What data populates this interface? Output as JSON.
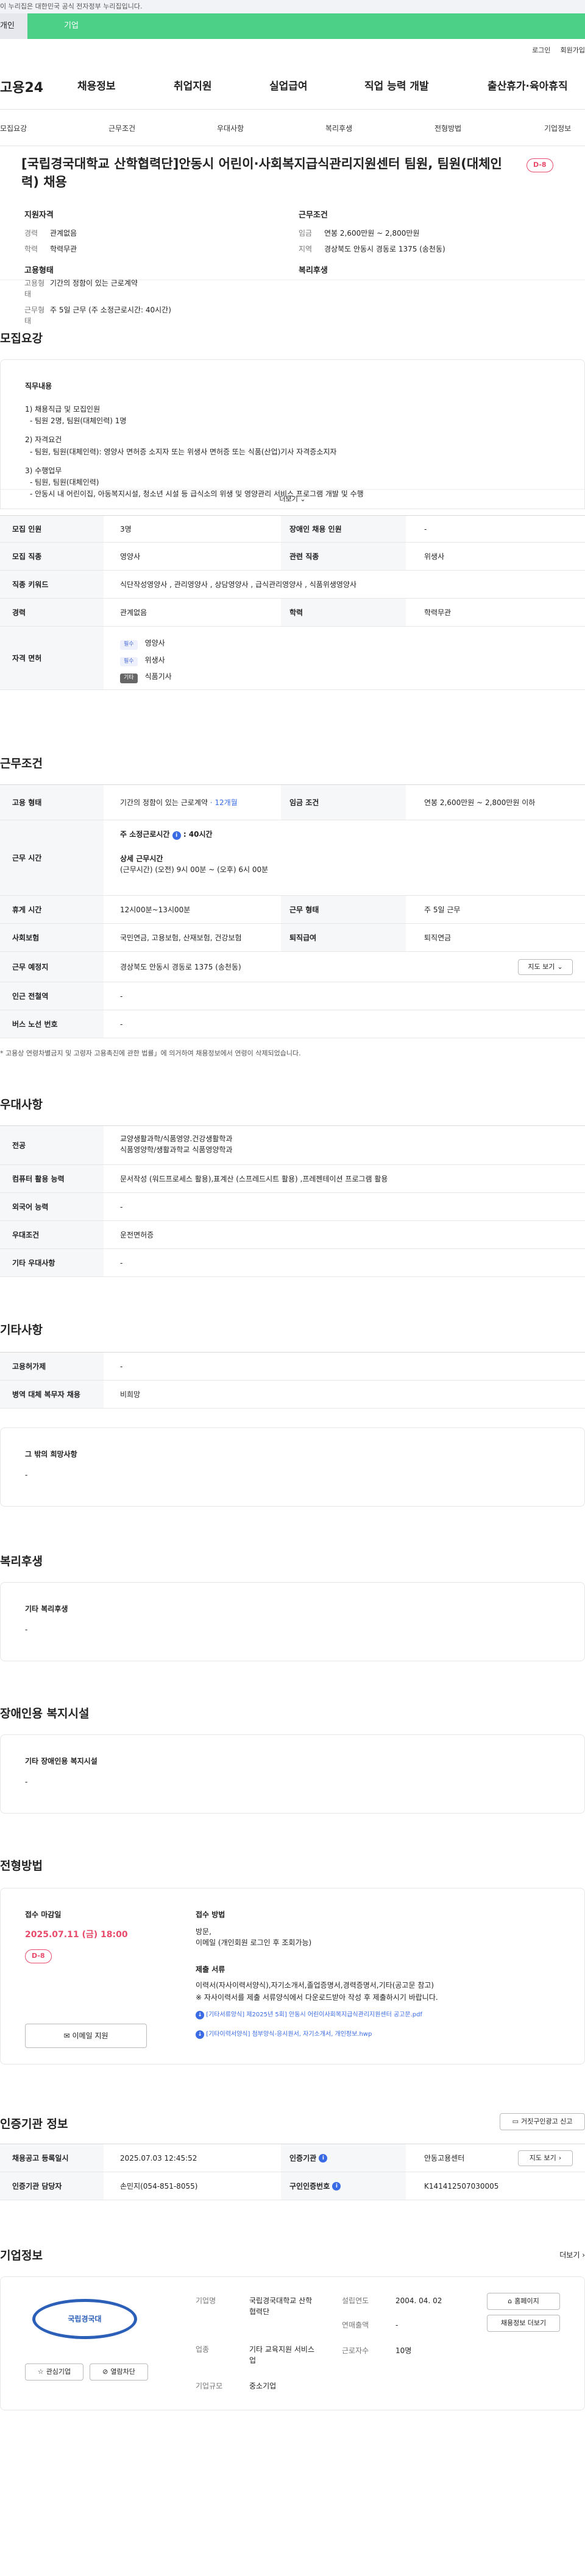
{
  "gov_banner": "이 누리집은 대한민국 공식 전자정부 누리집입니다.",
  "top_tabs": {
    "personal": "개인",
    "company": "기업"
  },
  "util": {
    "login": "로그인",
    "signup": "회원가입"
  },
  "gnb": {
    "logo": "고용24",
    "items": [
      "채용정보",
      "취업지원",
      "실업급여",
      "직업 능력 개발",
      "출산휴가·육아휴직"
    ]
  },
  "subnav": [
    "모집요강",
    "근무조건",
    "우대사항",
    "복리후생",
    "전형방법",
    "기업정보"
  ],
  "job": {
    "title": "[국립경국대학교 산학협력단]안동시 어린이·사회복지급식관리지원센터 팀원, 팀원(대체인력) 채용",
    "dday": "D-8",
    "qual_h": "지원자격",
    "career_k": "경력",
    "career_v": "관계없음",
    "edu_k": "학력",
    "edu_v": "학력무관",
    "cond_h": "근무조건",
    "wage_k": "임금",
    "wage_v": "연봉 2,600만원 ~ 2,800만원",
    "area_k": "지역",
    "area_v": "경상북도 안동시 경동로 1375 (송천동)",
    "emp_h": "고용형태",
    "emptype_k": "고용형태",
    "emptype_v": "기간의 정함이 있는 근로계약",
    "worktime_k": "근무형태",
    "worktime_v": "주 5일 근무 (주 소정근로시간: 40시간)",
    "welfare_h": "복리후생"
  },
  "recruit": {
    "title": "모집요강",
    "duty_h": "직무내용",
    "lines": [
      "1) 채용직급 및 모집인원",
      "- 팀원 2명, 팀원(대체인력) 1명",
      "2) 자격요건",
      "- 팀원, 팀원(대체인력): 영양사 면허증 소지자 또는 위생사 면허증 또는 식품(산업)기사 자격증소지자",
      "3) 수행업무",
      "- 팀원, 팀원(대체인력)",
      "- 안동시 내 어린이집, 아동복지시설, 청소년 시설 등 급식소의 위생 및 영양관리 서비스 프로그램 개발 및 수행"
    ],
    "more": "더보기",
    "rows": [
      {
        "k": "모집 인원",
        "v": "3명",
        "k2": "장애인 채용 인원",
        "v2": "-"
      },
      {
        "k": "모집 직종",
        "v": "영양사",
        "k2": "관련 직종",
        "v2": "위생사"
      },
      {
        "k": "직종 키워드",
        "v": "식단작성영양사 , 관리영양사 , 상담영양사 , 급식관리영양사 , 식품위생영양사"
      },
      {
        "k": "경력",
        "v": "관계없음",
        "k2": "학력",
        "v2": "학력무관"
      }
    ],
    "license_k": "자격 면허",
    "licenses": [
      {
        "tag": "필수",
        "name": "영양사"
      },
      {
        "tag": "필수",
        "name": "위생사"
      },
      {
        "tag": "기타",
        "name": "식품기사"
      }
    ]
  },
  "conditions": {
    "title": "근무조건",
    "emp_k": "고용 형태",
    "emp_v": "기간의 정함이 있는 근로계약",
    "emp_period": "· 12개월",
    "wage_k": "임금 조건",
    "wage_v": "연봉 2,600만원 ~ 2,800만원 이하",
    "time_k": "근무 시간",
    "weekly": "주 소정근로시간",
    "weekly_v": "40시간",
    "detail_h": "상세 근무시간",
    "detail_v": "(근무시간) (오전) 9시 00분 ~ (오후) 6시 00분",
    "rest_k": "휴게 시간",
    "rest_v": "12시00분~13시00분",
    "form_k": "근무 형태",
    "form_v": "주 5일 근무",
    "ins_k": "사회보험",
    "ins_v": "국민연금, 고용보험, 산재보험, 건강보험",
    "ret_k": "퇴직급여",
    "ret_v": "퇴직연금",
    "place_k": "근무 예정지",
    "place_v": "경상북도 안동시 경동로 1375 (송천동)",
    "map_btn": "지도 보기",
    "subway_k": "인근 전철역",
    "subway_v": "-",
    "bus_k": "버스 노선 번호",
    "bus_v": "-",
    "note": "* 고용상 연령차별금지 및 고령자 고용촉진에 관한 법률」에 의거하여 채용정보에서 연령이 삭제되었습니다."
  },
  "pref": {
    "title": "우대사항",
    "major_k": "전공",
    "major_v1": "교양생활과학/식품영양.건강생활학과",
    "major_v2": "식품영양학/생활과학교 식품영양학과",
    "pc_k": "컴퓨터 활용 능력",
    "pc_v": "문서작성 (워드프로세스 활용),표계산 (스프레드시트 활용) ,프레젠테이션 프로그램 활용",
    "lang_k": "외국어 능력",
    "lang_v": "-",
    "cond_k": "우대조건",
    "cond_v": "운전면허증",
    "etc_k": "기타 우대사항",
    "etc_v": "-"
  },
  "etc": {
    "title": "기타사항",
    "k1": "고용허가제",
    "v1": "-",
    "k2": "병역 대체 복무자 채용",
    "v2": "비희망",
    "other_h": "그 밖의 희망사항",
    "other_v": "-"
  },
  "welfare": {
    "title": "복리후생",
    "h": "기타 복리후생",
    "v": "-"
  },
  "disab": {
    "title": "장애인용 복지시설",
    "h": "기타 장애인용 복지시설",
    "v": "-"
  },
  "process": {
    "title": "전형방법",
    "deadline_h": "접수 마감일",
    "deadline_v": "2025.07.11 (금) 18:00",
    "dday": "D-8",
    "email_btn": "이메일 지원",
    "method_h": "접수 방법",
    "method_v": "방문,",
    "method_v2": "이메일 (개인회원 로그인 후 조회가능)",
    "docs_h": "제출 서류",
    "docs_v": "이력서(자사이력서양식),자기소개서,졸업증명서,경력증명서,기타(공고문 참고)",
    "docs_note": "※ 자사이력서를 제출 서류양식에서 다운로드받아 작성 후 제출하시기 바랍니다.",
    "file1": "[기타서류양식] 제2025년 5회] 안동시 어린이사회복지급식관리지원센터 공고문.pdf",
    "file2": "[기타이력서양식] 첨부양식-응시원서, 자기소개서, 개인정보.hwp"
  },
  "agency": {
    "title": "인증기관 정보",
    "report_btn": "거짓구인광고 신고",
    "reg_k": "채용공고 등록일시",
    "reg_v": "2025.07.03 12:45:52",
    "org_k": "인증기관",
    "org_v": "안동고용센터",
    "map_btn": "지도 보기",
    "mgr_k": "인증기관 담당자",
    "mgr_v": "손민지(054-851-8055)",
    "no_k": "구인인증번호",
    "no_v": "K141412507030005"
  },
  "company": {
    "title": "기업정보",
    "more": "더보기",
    "logo_text": "국립경국대",
    "fav": "관심기업",
    "block": "열람차단",
    "name_k": "기업명",
    "name_v": "국립경국대학교 산학협력단",
    "found_k": "설립연도",
    "found_v": "2004. 04. 02",
    "sales_k": "연매출액",
    "sales_v": "-",
    "ind_k": "업종",
    "ind_v": "기타 교육지원 서비스업",
    "emp_k": "근로자수",
    "emp_v": "10명",
    "size_k": "기업규모",
    "size_v": "중소기업",
    "home_btn": "홈페이지",
    "jobs_btn": "채용정보 더보기"
  },
  "colors": {
    "accent": "#4ccf86",
    "badge": "#e74a6b",
    "link": "#3a6be5"
  }
}
